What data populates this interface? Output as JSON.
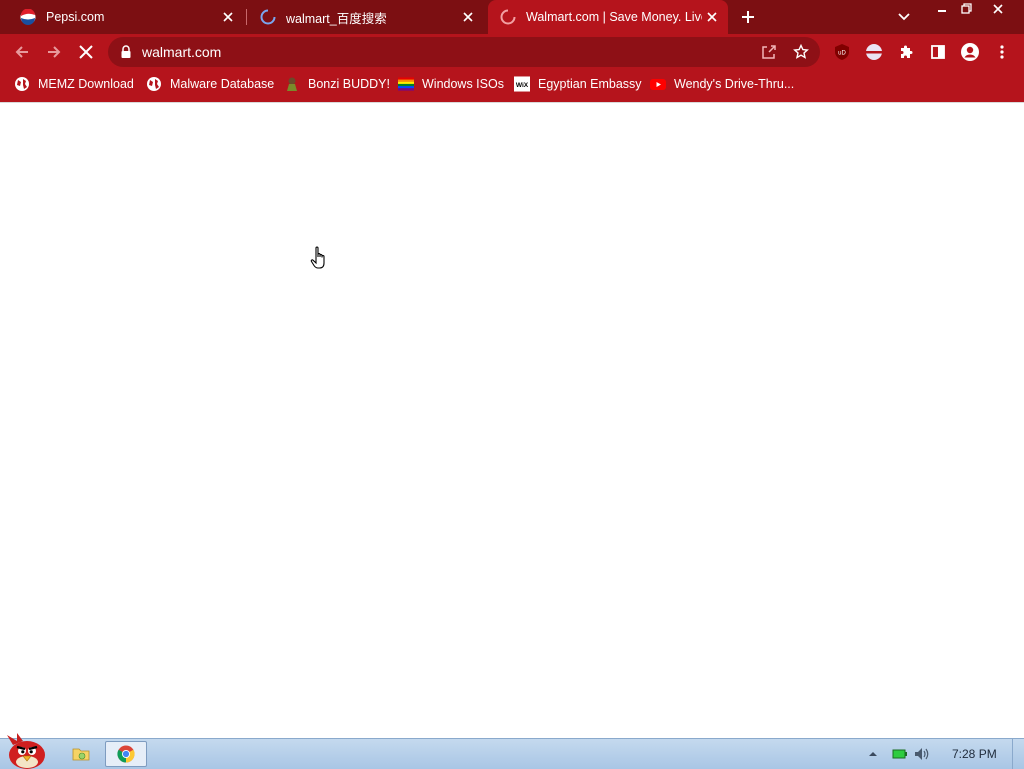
{
  "tabs": [
    {
      "title": "Pepsi.com",
      "favicon": "pepsi-icon"
    },
    {
      "title": "walmart_百度搜索",
      "favicon": "loading-spinner-icon"
    },
    {
      "title": "Walmart.com | Save Money. Live",
      "favicon": "loading-spinner-icon",
      "active": true
    }
  ],
  "omnibox": {
    "url": "walmart.com"
  },
  "bookmarks": [
    {
      "label": "MEMZ Download",
      "icon": "globe-icon"
    },
    {
      "label": "Malware Database",
      "icon": "globe-icon"
    },
    {
      "label": "Bonzi BUDDY!",
      "icon": "bonzi-icon"
    },
    {
      "label": "Windows ISOs",
      "icon": "rainbow-flag-icon"
    },
    {
      "label": "Egyptian Embassy",
      "icon": "wix-icon"
    },
    {
      "label": "Wendy's Drive-Thru...",
      "icon": "youtube-icon"
    }
  ],
  "taskbar": {
    "clock": "7:28 PM"
  },
  "colors": {
    "tabstrip": "#7c0f12",
    "toolbar": "#b5141c",
    "omnibox": "#8e1016",
    "taskbar": "#b6cfe9"
  }
}
